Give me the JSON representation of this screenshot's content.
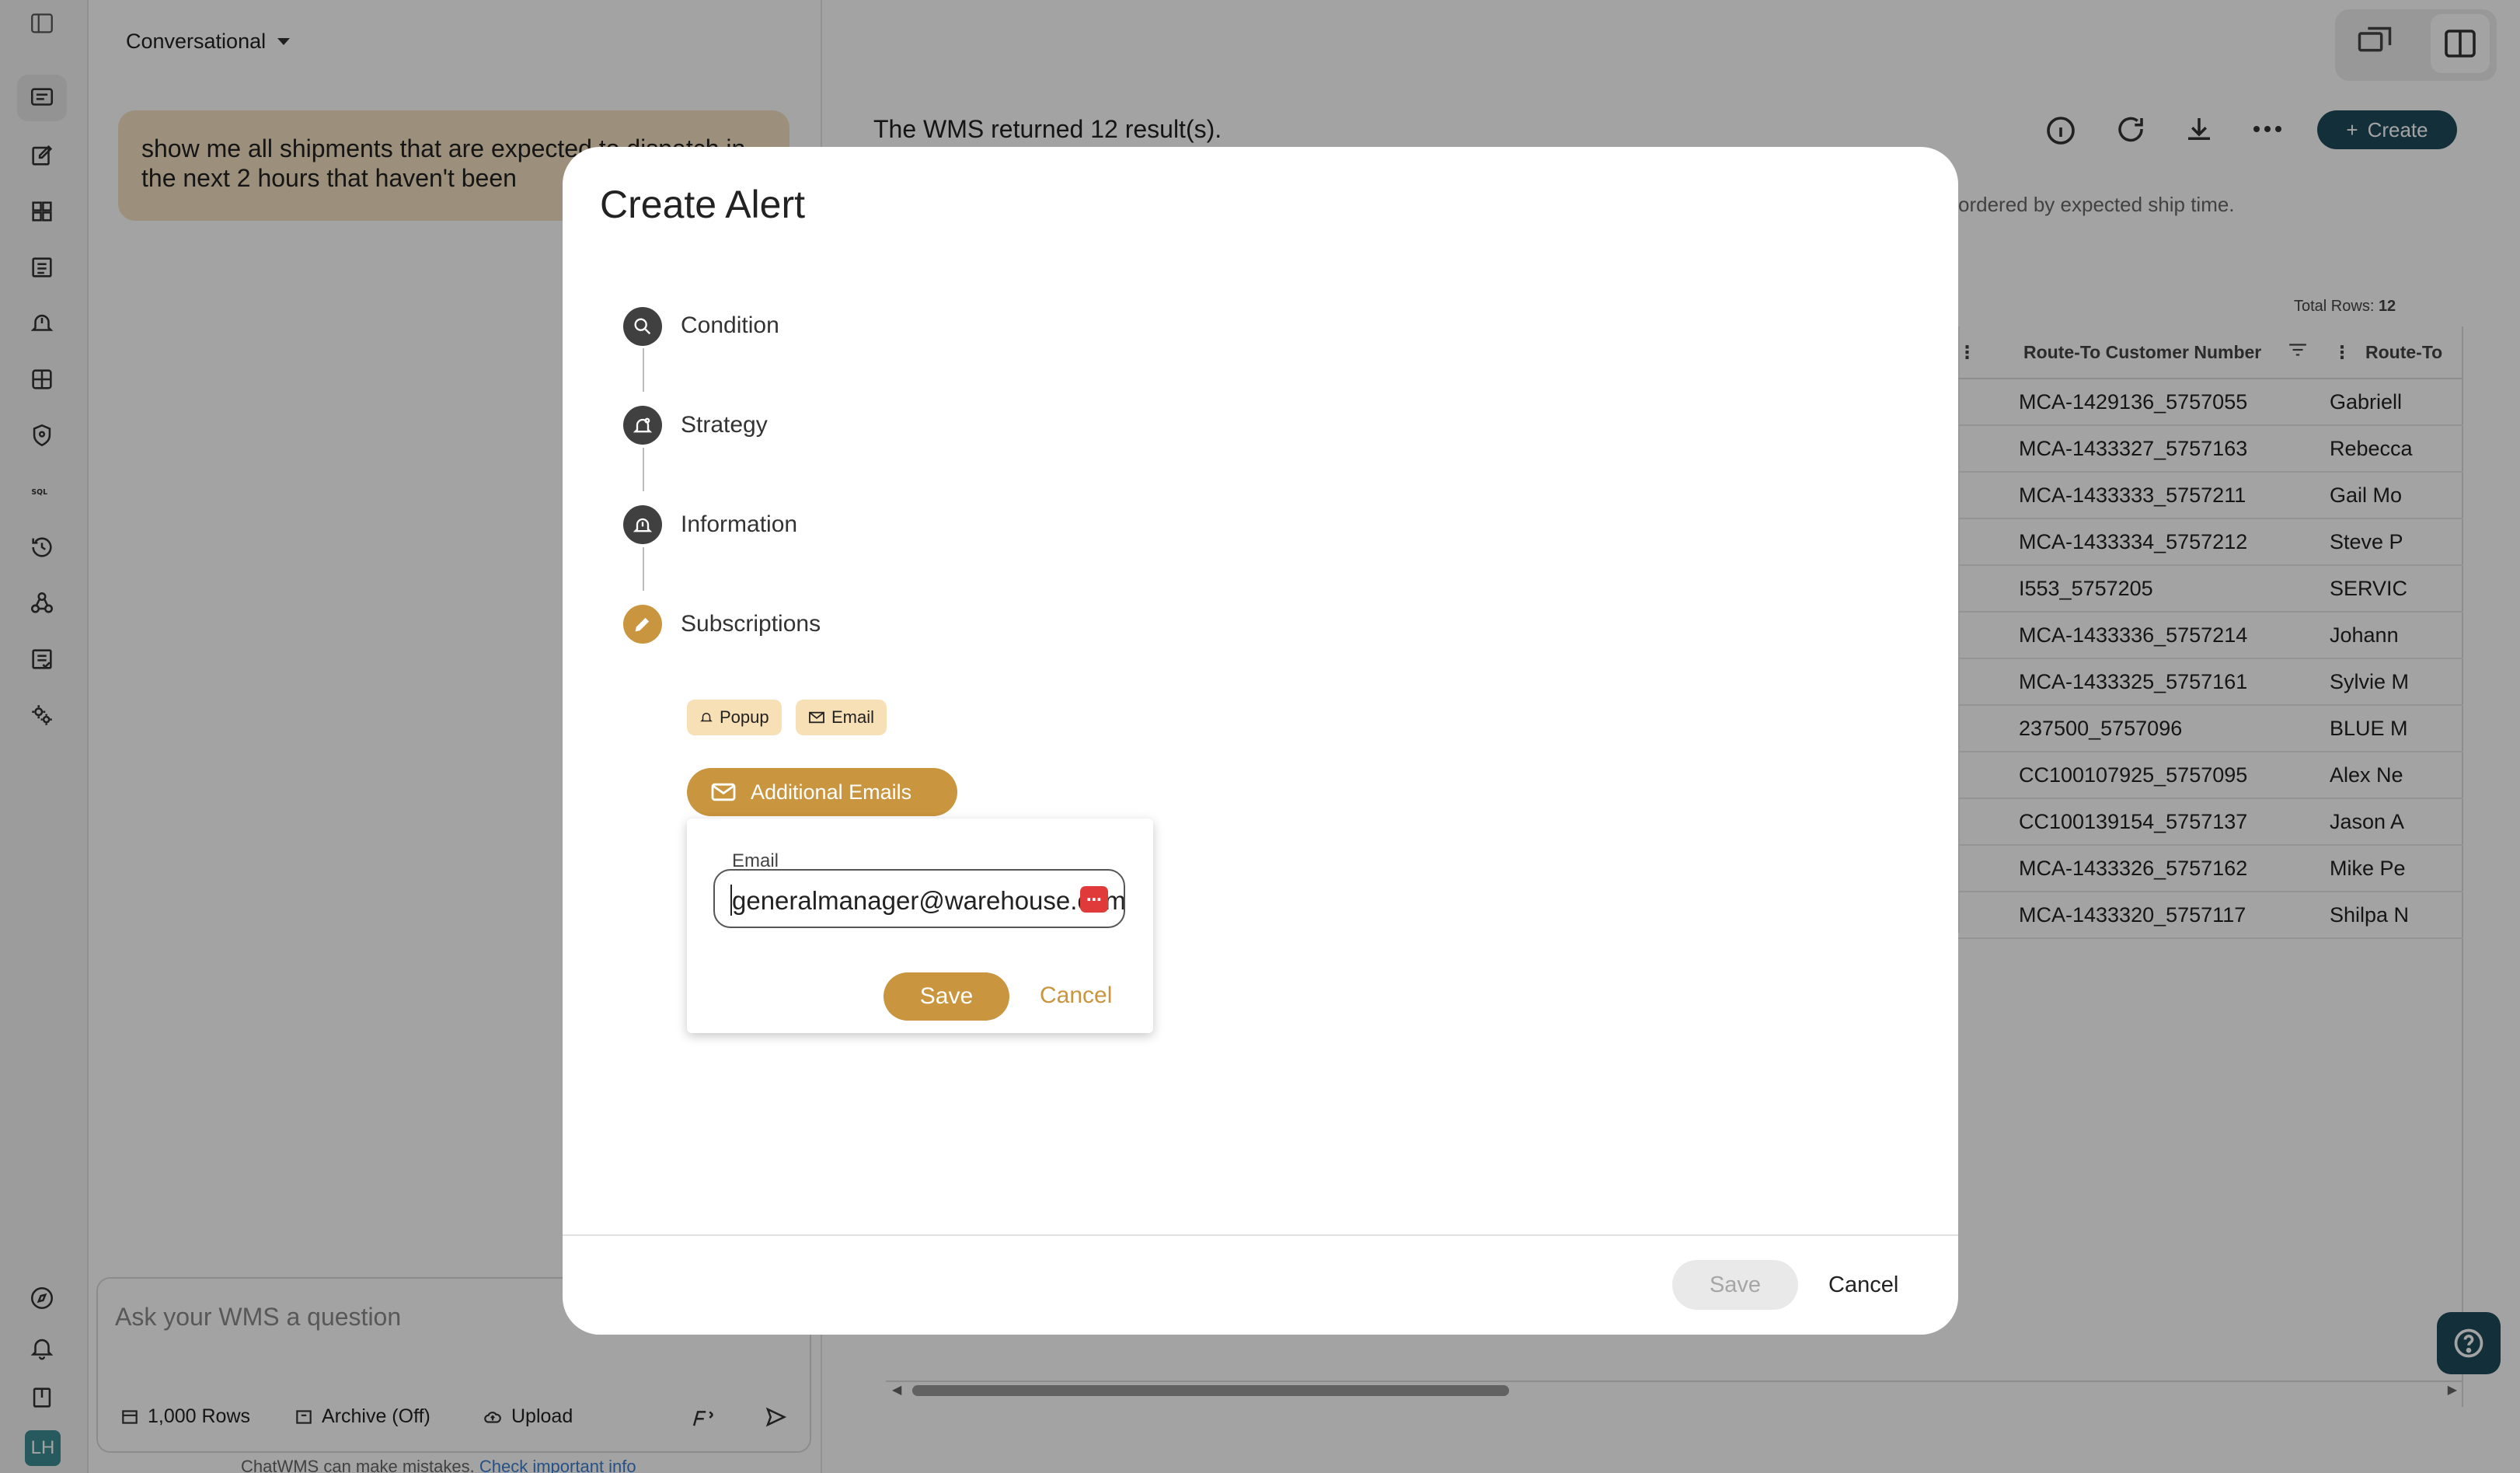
{
  "rail": {
    "avatar": "LH"
  },
  "chat": {
    "mode": "Conversational",
    "user_message": "show me all shipments that are expected to dispatch in the next 2 hours that haven't been",
    "input_placeholder": "Ask your WMS a question",
    "tools": {
      "rows": "1,000 Rows",
      "archive": "Archive (Off)",
      "upload": "Upload"
    },
    "disclaimer": "ChatWMS can make mistakes.",
    "disclaimer_link": "Check important info"
  },
  "results": {
    "summary": "The WMS returned 12 result(s).",
    "subtext": "ordered by expected ship time.",
    "create_label": "Create",
    "total_rows_label": "Total Rows:",
    "total_rows_value": "12",
    "columns": [
      "Route-To Customer Number",
      "Route-To"
    ],
    "rows": [
      [
        "MCA-1429136_5757055",
        "Gabriell"
      ],
      [
        "MCA-1433327_5757163",
        "Rebecca"
      ],
      [
        "MCA-1433333_5757211",
        "Gail Mo"
      ],
      [
        "MCA-1433334_5757212",
        "Steve P"
      ],
      [
        "I553_5757205",
        "SERVIC"
      ],
      [
        "MCA-1433336_5757214",
        "Johann"
      ],
      [
        "MCA-1433325_5757161",
        "Sylvie M"
      ],
      [
        "237500_5757096",
        "BLUE M"
      ],
      [
        "CC100107925_5757095",
        "Alex Ne"
      ],
      [
        "CC100139154_5757137",
        "Jason A"
      ],
      [
        "MCA-1433326_5757162",
        "Mike Pe"
      ],
      [
        "MCA-1433320_5757117",
        "Shilpa N"
      ]
    ]
  },
  "modal": {
    "title": "Create Alert",
    "steps": [
      "Condition",
      "Strategy",
      "Information",
      "Subscriptions"
    ],
    "chips": {
      "popup": "Popup",
      "email": "Email"
    },
    "additional_emails_label": "Additional Emails",
    "email_field_label": "Email",
    "email_value": "generalmanager@warehouse.com",
    "password_manager_badge": "⋯",
    "card_save": "Save",
    "card_cancel": "Cancel",
    "footer_save": "Save",
    "footer_cancel": "Cancel"
  },
  "colors": {
    "accent_gold": "#c9953e",
    "chip_bg": "#f7dfb6",
    "brand_dark": "#1f4a5c",
    "bubble_bg": "#f5e1c2"
  }
}
